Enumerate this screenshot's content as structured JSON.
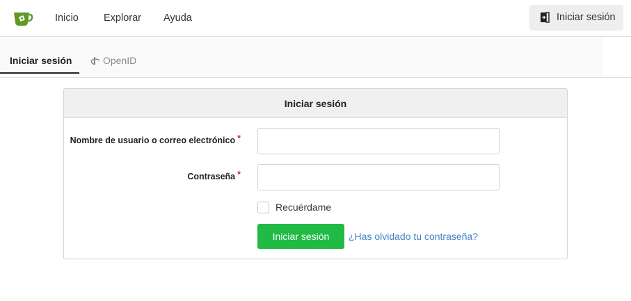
{
  "navbar": {
    "logo_icon": "gitea-teacup-logo-icon",
    "brand_color": "#609926",
    "items": [
      {
        "label": "Inicio"
      },
      {
        "label": "Explorar"
      },
      {
        "label": "Ayuda"
      }
    ],
    "signin_label": "Iniciar sesión",
    "signin_icon": "sign-in-door-icon"
  },
  "tabs": [
    {
      "label": "Iniciar sesión",
      "active": true
    },
    {
      "label": "OpenID",
      "icon": "openid-icon",
      "active": false
    }
  ],
  "form": {
    "title": "Iniciar sesión",
    "username_label": "Nombre de usuario o correo electrónico",
    "username_value": "",
    "password_label": "Contraseña",
    "password_value": "",
    "required_marker": "*",
    "remember_label": "Recuérdame",
    "remember_checked": false,
    "submit_label": "Iniciar sesión",
    "submit_color": "#21ba45",
    "forgot_label": "¿Has olvidado tu contraseña?",
    "link_color": "#4183c4"
  }
}
